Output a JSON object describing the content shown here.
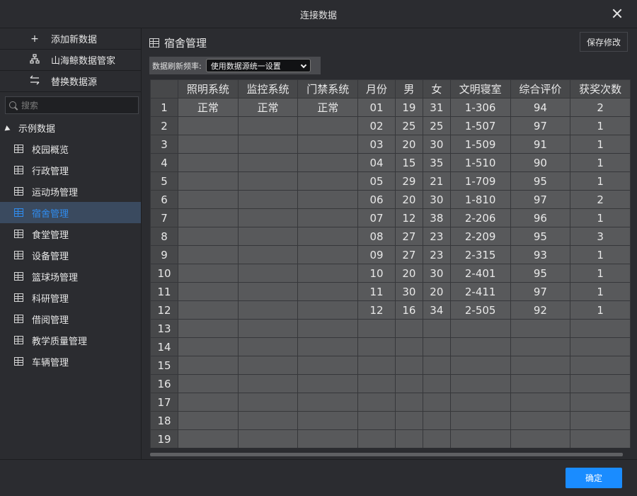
{
  "window": {
    "title": "连接数据"
  },
  "sidebar": {
    "actions": [
      {
        "label": "添加新数据",
        "icon": "plus-icon"
      },
      {
        "label": "山海鲸数据管家",
        "icon": "hierarchy-icon"
      },
      {
        "label": "替换数据源",
        "icon": "swap-icon"
      }
    ],
    "search_placeholder": "搜索",
    "root_label": "示例数据",
    "items": [
      {
        "label": "校园概览",
        "active": false
      },
      {
        "label": "行政管理",
        "active": false
      },
      {
        "label": "运动场管理",
        "active": false
      },
      {
        "label": "宿舍管理",
        "active": true
      },
      {
        "label": "食堂管理",
        "active": false
      },
      {
        "label": "设备管理",
        "active": false
      },
      {
        "label": "篮球场管理",
        "active": false
      },
      {
        "label": "科研管理",
        "active": false
      },
      {
        "label": "借阅管理",
        "active": false
      },
      {
        "label": "教学质量管理",
        "active": false
      },
      {
        "label": "车辆管理",
        "active": false
      }
    ]
  },
  "main": {
    "title": "宿舍管理",
    "save_label": "保存修改",
    "refresh_label": "数据刷新频率:",
    "refresh_value": "使用数据源统一设置",
    "table": {
      "headers": [
        "照明系统",
        "监控系统",
        "门禁系统",
        "月份",
        "男",
        "女",
        "文明寝室",
        "综合评价",
        "获奖次数"
      ],
      "rows": [
        [
          "正常",
          "正常",
          "正常",
          "01",
          "19",
          "31",
          "1-306",
          "94",
          "2"
        ],
        [
          "",
          "",
          "",
          "02",
          "25",
          "25",
          "1-507",
          "97",
          "1"
        ],
        [
          "",
          "",
          "",
          "03",
          "20",
          "30",
          "1-509",
          "91",
          "1"
        ],
        [
          "",
          "",
          "",
          "04",
          "15",
          "35",
          "1-510",
          "90",
          "1"
        ],
        [
          "",
          "",
          "",
          "05",
          "29",
          "21",
          "1-709",
          "95",
          "1"
        ],
        [
          "",
          "",
          "",
          "06",
          "20",
          "30",
          "1-810",
          "97",
          "2"
        ],
        [
          "",
          "",
          "",
          "07",
          "12",
          "38",
          "2-206",
          "96",
          "1"
        ],
        [
          "",
          "",
          "",
          "08",
          "27",
          "23",
          "2-209",
          "95",
          "3"
        ],
        [
          "",
          "",
          "",
          "09",
          "27",
          "23",
          "2-315",
          "93",
          "1"
        ],
        [
          "",
          "",
          "",
          "10",
          "20",
          "30",
          "2-401",
          "95",
          "1"
        ],
        [
          "",
          "",
          "",
          "11",
          "30",
          "20",
          "2-411",
          "97",
          "1"
        ],
        [
          "",
          "",
          "",
          "12",
          "16",
          "34",
          "2-505",
          "92",
          "1"
        ],
        [
          "",
          "",
          "",
          "",
          "",
          "",
          "",
          "",
          ""
        ],
        [
          "",
          "",
          "",
          "",
          "",
          "",
          "",
          "",
          ""
        ],
        [
          "",
          "",
          "",
          "",
          "",
          "",
          "",
          "",
          ""
        ],
        [
          "",
          "",
          "",
          "",
          "",
          "",
          "",
          "",
          ""
        ],
        [
          "",
          "",
          "",
          "",
          "",
          "",
          "",
          "",
          ""
        ],
        [
          "",
          "",
          "",
          "",
          "",
          "",
          "",
          "",
          ""
        ],
        [
          "",
          "",
          "",
          "",
          "",
          "",
          "",
          "",
          ""
        ]
      ]
    }
  },
  "footer": {
    "ok_label": "确定"
  },
  "colors": {
    "accent": "#1a8cff",
    "active_text": "#2f8cf0",
    "active_bg": "#3a4a5f"
  }
}
